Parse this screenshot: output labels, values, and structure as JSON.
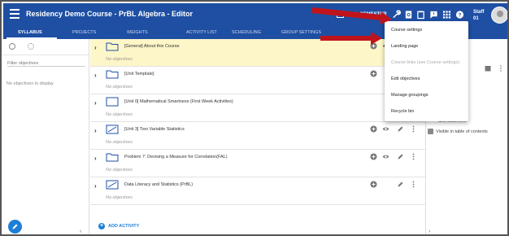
{
  "app": {
    "title": "Residency Demo Course - PrBL Algebra - Editor",
    "semester": "FALL SEMESTER",
    "user_line1": "Staff",
    "user_line2": "01"
  },
  "tabs": [
    {
      "label": "SYLLABUS",
      "active": true
    },
    {
      "label": "PROJECTS"
    },
    {
      "label": "WEIGHTS"
    },
    {
      "label": "ACTIVITY LIST"
    },
    {
      "label": "SCHEDULING"
    },
    {
      "label": "GROUP SETTINGS"
    }
  ],
  "sidebar": {
    "filter_placeholder": "Filter objectives",
    "empty_text": "No objectives to display"
  },
  "rows": [
    {
      "label": "[General] About this Course",
      "objectives": "No objectives",
      "icon": "folder-icon",
      "highlight": true
    },
    {
      "label": "[Unit Template]",
      "objectives": "No objectives",
      "icon": "folder-icon"
    },
    {
      "label": "[Unit 0] Mathematical Smartness (First Week Activities)",
      "objectives": "No objectives",
      "icon": "chart-icon"
    },
    {
      "label": "[Unit 3] Two Variable Statistics",
      "objectives": "No objectives",
      "icon": "chart-icon"
    },
    {
      "label": "Problem 7: Devising a Measure for Correlation(FAL)",
      "objectives": "No objectives",
      "icon": "folder-icon"
    },
    {
      "label": "Data Literacy and Statistics (PrBL)",
      "objectives": "No objectives",
      "icon": "chart-icon"
    }
  ],
  "add_activity": "ADD ACTIVITY",
  "right_panel": {
    "text": "and observers",
    "checkbox_label": "Visible in table of contents"
  },
  "dropdown": {
    "items": [
      {
        "label": "Course settings"
      },
      {
        "label": "Landing page"
      },
      {
        "label": "Course links (see Course settings)",
        "disabled": true
      },
      {
        "label": "Edit objectives"
      },
      {
        "label": "Manage groupings"
      },
      {
        "label": "Recycle bin"
      }
    ]
  },
  "colors": {
    "appbar": "#1e4fa3",
    "highlight_row": "#fdf6c8",
    "accent": "#1e7fd6",
    "arrow": "#c0141c"
  }
}
